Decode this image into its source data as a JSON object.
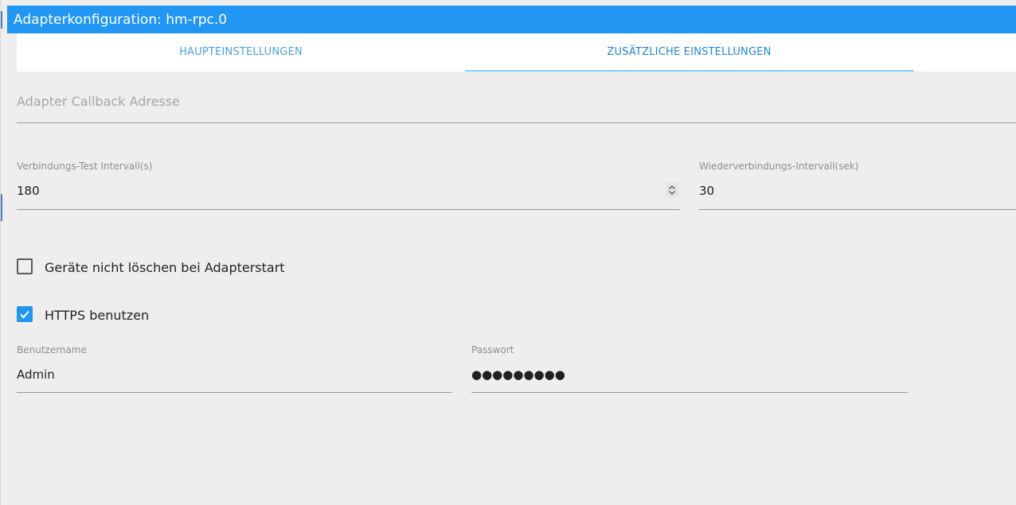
{
  "window": {
    "title": "Adapterkonfiguration: hm-rpc.0"
  },
  "tabs": [
    {
      "label": "HAUPTEINSTELLUNGEN",
      "active": false
    },
    {
      "label": "ZUSÄTZLICHE EINSTELLUNGEN",
      "active": true
    }
  ],
  "form": {
    "callback": {
      "placeholder": "Adapter Callback Adresse",
      "value": ""
    },
    "connection_test_interval": {
      "label": "Verbindungs-Test Intervall(s)",
      "value": "180"
    },
    "reconnect_interval": {
      "label": "Wiederverbindungs-Intervall(sek)",
      "value": "30"
    },
    "dont_delete_devices": {
      "label": "Geräte nicht löschen bei Adapterstart",
      "checked": false
    },
    "use_https": {
      "label": "HTTPS benutzen",
      "checked": true
    },
    "username": {
      "label": "Benutzername",
      "value": "Admin"
    },
    "password": {
      "label": "Passwort",
      "value": "●●●●●●●●●"
    }
  },
  "colors": {
    "accent": "#2196f3",
    "background": "#eeeeee",
    "tab_indicator": "#90caf9"
  },
  "icons": {
    "spinner": "number-spinner-icon",
    "check": "checkmark-icon"
  }
}
